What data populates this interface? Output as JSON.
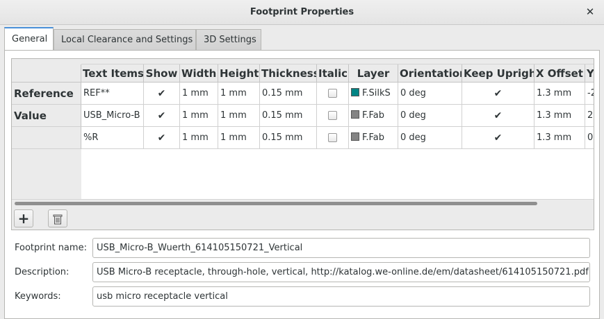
{
  "window": {
    "title": "Footprint Properties"
  },
  "tabs": [
    {
      "label": "General"
    },
    {
      "label": "Local Clearance and Settings"
    },
    {
      "label": "3D Settings"
    }
  ],
  "grid": {
    "columns": [
      "Text Items",
      "Show",
      "Width",
      "Height",
      "Thickness",
      "Italic",
      "Layer",
      "Orientation",
      "Keep Upright",
      "X Offset",
      "Y"
    ],
    "rows": [
      {
        "label": "Reference",
        "text": "REF**",
        "show": true,
        "width": "1 mm",
        "height": "1 mm",
        "thickness": "0.15 mm",
        "italic": false,
        "layer": "F.SilkS",
        "layer_color": "#008484",
        "orientation": "0 deg",
        "keep_upright": true,
        "x_offset": "1.3 mm",
        "y_offset": "-2"
      },
      {
        "label": "Value",
        "text": "USB_Micro-B",
        "show": true,
        "width": "1 mm",
        "height": "1 mm",
        "thickness": "0.15 mm",
        "italic": false,
        "layer": "F.Fab",
        "layer_color": "#848484",
        "orientation": "0 deg",
        "keep_upright": true,
        "x_offset": "1.3 mm",
        "y_offset": "2."
      },
      {
        "label": "",
        "text": "%R",
        "show": true,
        "width": "1 mm",
        "height": "1 mm",
        "thickness": "0.15 mm",
        "italic": false,
        "layer": "F.Fab",
        "layer_color": "#848484",
        "orientation": "0 deg",
        "keep_upright": true,
        "x_offset": "1.3 mm",
        "y_offset": "0."
      }
    ],
    "add_icon": "plus-icon",
    "delete_icon": "trash-icon"
  },
  "form": {
    "footprint_name_label": "Footprint name:",
    "footprint_name_value": "USB_Micro-B_Wuerth_614105150721_Vertical",
    "description_label": "Description:",
    "description_value": "USB Micro-B receptacle, through-hole, vertical, http://katalog.we-online.de/em/datasheet/614105150721.pdf",
    "keywords_label": "Keywords:",
    "keywords_value": "usb micro receptacle vertical"
  }
}
